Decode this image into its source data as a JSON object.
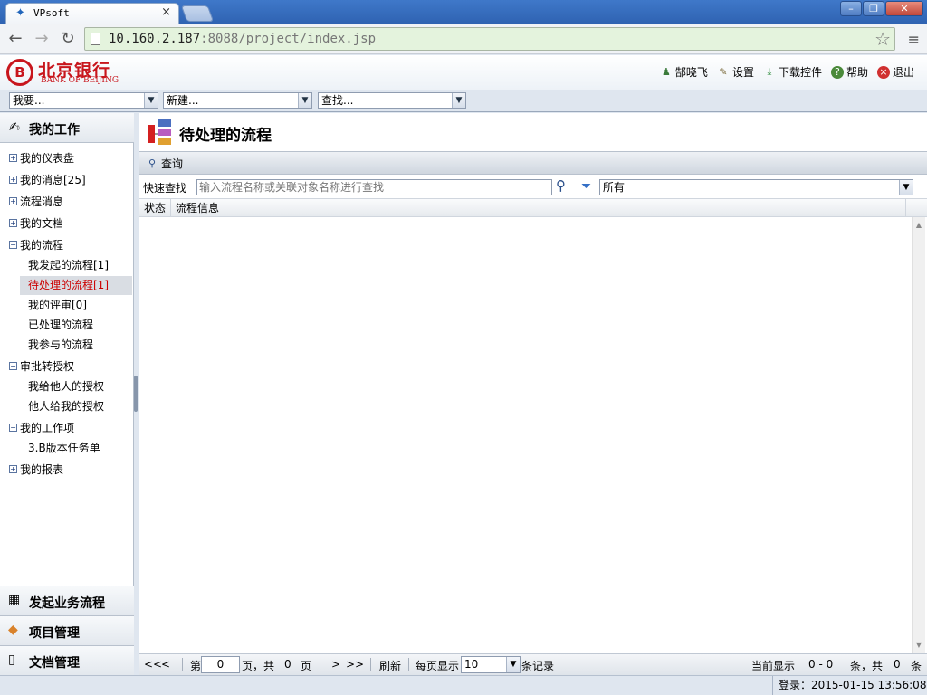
{
  "browser": {
    "tab_title": "VPsoft",
    "url_host": "10.160.2.187",
    "url_rest": ":8088/project/index.jsp"
  },
  "header": {
    "logo_cn": "北京银行",
    "logo_en": "BANK OF BEIJING",
    "user": "郜晓飞",
    "settings": "设置",
    "download": "下载控件",
    "help": "帮助",
    "logout": "退出"
  },
  "selects": {
    "want": "我要...",
    "new": "新建...",
    "find": "查找..."
  },
  "sidebar": {
    "title": "我的工作",
    "items": [
      {
        "label": "我的仪表盘",
        "expanded": false
      },
      {
        "label": "我的消息[25]",
        "expanded": false
      },
      {
        "label": "流程消息",
        "expanded": false
      },
      {
        "label": "我的文档",
        "expanded": false
      },
      {
        "label": "我的流程",
        "expanded": true
      },
      {
        "label": "审批转授权",
        "expanded": true
      },
      {
        "label": "我的工作项",
        "expanded": true
      },
      {
        "label": "我的报表",
        "expanded": false
      }
    ],
    "my_process_children": [
      "我发起的流程[1]",
      "待处理的流程[1]",
      "我的评审[0]",
      "已处理的流程",
      "我参与的流程"
    ],
    "approval_children": [
      "我给他人的授权",
      "他人给我的授权"
    ],
    "workitem_children": [
      "3.B版本任务单"
    ],
    "sections": [
      "发起业务流程",
      "项目管理",
      "文档管理"
    ]
  },
  "main": {
    "title": "待处理的流程",
    "query_label": "查询",
    "quick_find_label": "快速查找",
    "search_placeholder": "输入流程名称或关联对象名称进行查找",
    "filter_value": "所有",
    "columns": [
      "状态",
      "流程信息"
    ],
    "rows": []
  },
  "pager": {
    "first": "<<",
    "prev": "<",
    "page_prefix": "第",
    "page_value": "0",
    "page_suffix": "页，共",
    "total_pages": "0",
    "page_unit": "页",
    "next": ">",
    "last": ">>",
    "refresh": "刷新",
    "per_page_label": "每页显示",
    "per_page_value": "10",
    "records_label": "条记录",
    "current_label": "当前显示",
    "range": "0 - 0",
    "total_prefix": "条，共",
    "total_count": "0",
    "total_unit": "条"
  },
  "status": {
    "login_time": "登录：2015-01-15 13:56:08"
  },
  "colors": {
    "brand_red": "#c8161d",
    "active_item": "#cc0000"
  }
}
